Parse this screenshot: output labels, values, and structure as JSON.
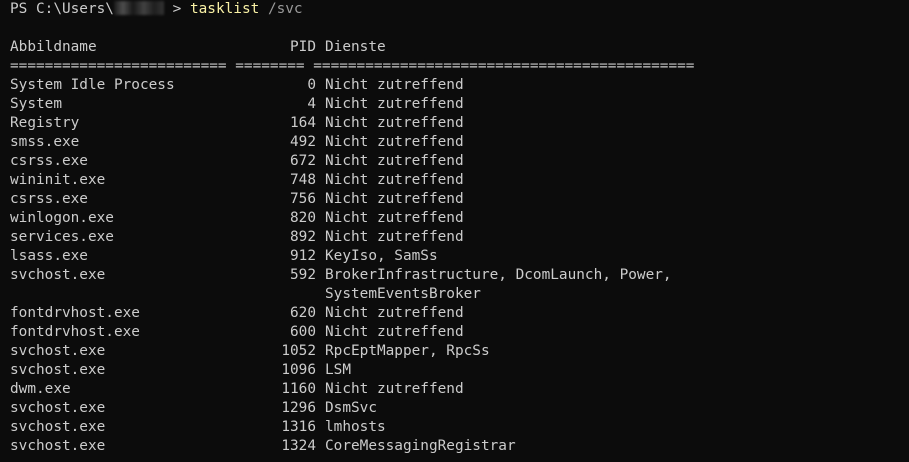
{
  "prompt": {
    "prefix": "PS C:\\Users\\",
    "suffix": " > ",
    "command": "tasklist",
    "argument": " /svc"
  },
  "table": {
    "headers": {
      "name": "Abbildname",
      "pid": "PID",
      "services": "Dienste"
    },
    "separator": "========================= ======== ============================================",
    "rows": [
      {
        "name": "System Idle Process",
        "pid": "0",
        "services": "Nicht zutreffend"
      },
      {
        "name": "System",
        "pid": "4",
        "services": "Nicht zutreffend"
      },
      {
        "name": "Registry",
        "pid": "164",
        "services": "Nicht zutreffend"
      },
      {
        "name": "smss.exe",
        "pid": "492",
        "services": "Nicht zutreffend"
      },
      {
        "name": "csrss.exe",
        "pid": "672",
        "services": "Nicht zutreffend"
      },
      {
        "name": "wininit.exe",
        "pid": "748",
        "services": "Nicht zutreffend"
      },
      {
        "name": "csrss.exe",
        "pid": "756",
        "services": "Nicht zutreffend"
      },
      {
        "name": "winlogon.exe",
        "pid": "820",
        "services": "Nicht zutreffend"
      },
      {
        "name": "services.exe",
        "pid": "892",
        "services": "Nicht zutreffend"
      },
      {
        "name": "lsass.exe",
        "pid": "912",
        "services": "KeyIso, SamSs"
      },
      {
        "name": "svchost.exe",
        "pid": "592",
        "services": "BrokerInfrastructure, DcomLaunch, Power,"
      },
      {
        "name": "",
        "pid": "",
        "services": "SystemEventsBroker"
      },
      {
        "name": "fontdrvhost.exe",
        "pid": "620",
        "services": "Nicht zutreffend"
      },
      {
        "name": "fontdrvhost.exe",
        "pid": "600",
        "services": "Nicht zutreffend"
      },
      {
        "name": "svchost.exe",
        "pid": "1052",
        "services": "RpcEptMapper, RpcSs"
      },
      {
        "name": "svchost.exe",
        "pid": "1096",
        "services": "LSM"
      },
      {
        "name": "dwm.exe",
        "pid": "1160",
        "services": "Nicht zutreffend"
      },
      {
        "name": "svchost.exe",
        "pid": "1296",
        "services": "DsmSvc"
      },
      {
        "name": "svchost.exe",
        "pid": "1316",
        "services": "lmhosts"
      },
      {
        "name": "svchost.exe",
        "pid": "1324",
        "services": "CoreMessagingRegistrar"
      }
    ]
  },
  "colors": {
    "background": "#0c0c0c",
    "text": "#cccccc",
    "command": "#f9f1a5",
    "argument": "#9a9a9a"
  }
}
